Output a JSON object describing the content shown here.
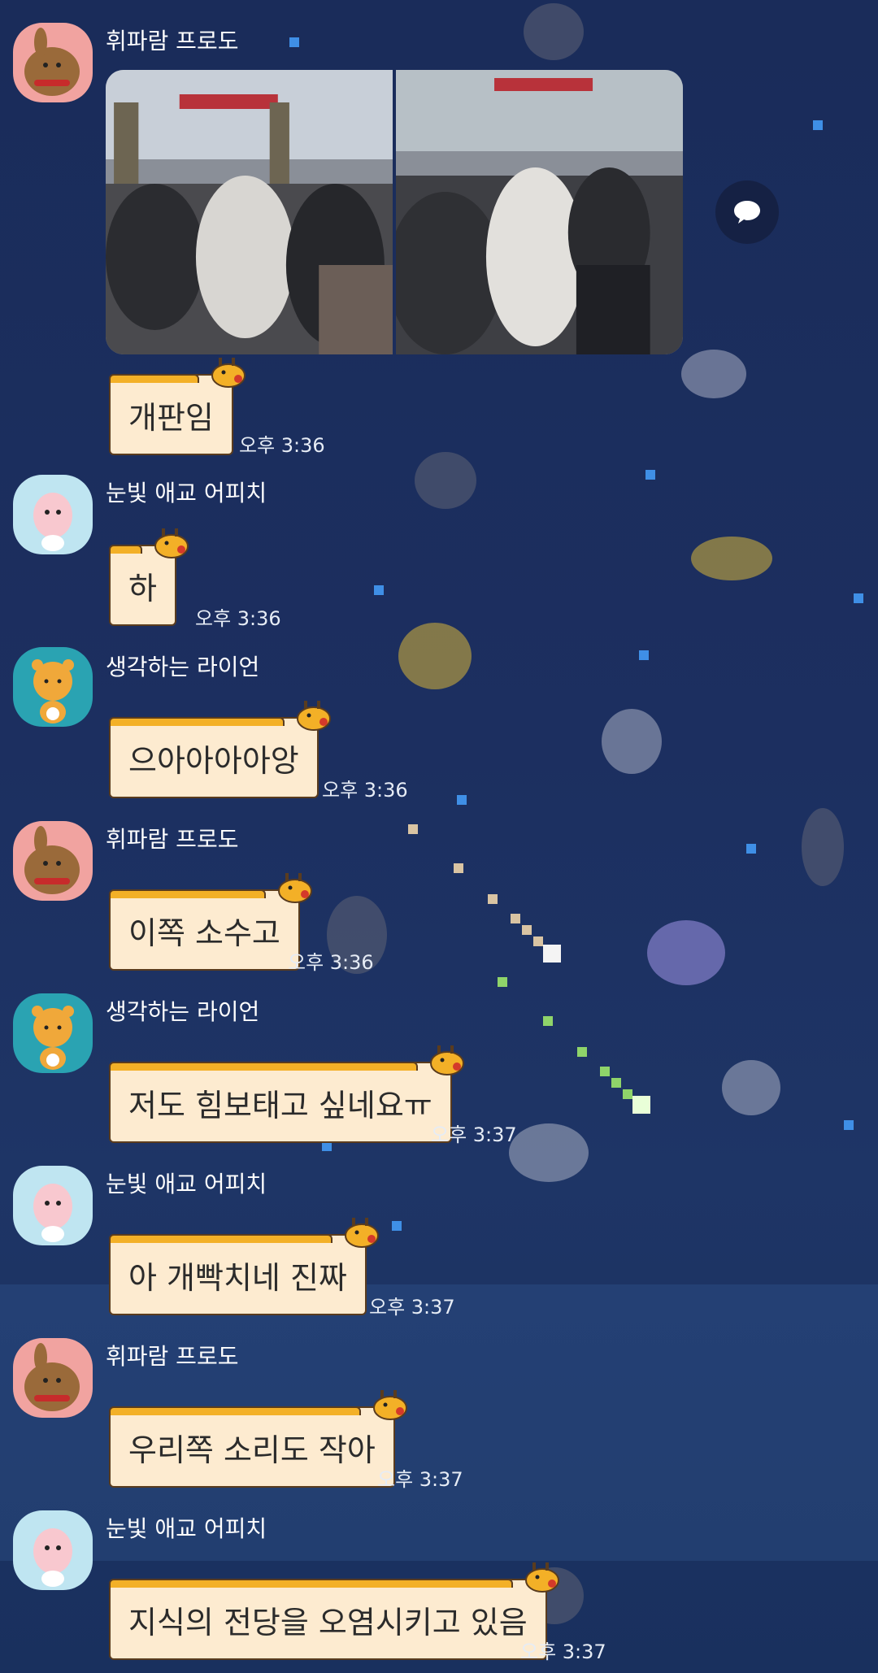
{
  "messages": [
    {
      "sender": "휘파람 프로도",
      "avatar": "frodo-avatar-icon",
      "text": "개판임",
      "time": "오후 3:36"
    },
    {
      "sender": "눈빛 애교 어피치",
      "avatar": "apeach-avatar-icon",
      "text": "하",
      "time": "오후 3:36"
    },
    {
      "sender": "생각하는 라이언",
      "avatar": "ryan-avatar-icon",
      "text": "으아아아아앙",
      "time": "오후 3:36"
    },
    {
      "sender": "휘파람 프로도",
      "avatar": "frodo-avatar-icon",
      "text": "이쪽 소수고",
      "time": "오후 3:36"
    },
    {
      "sender": "생각하는 라이언",
      "avatar": "ryan-avatar-icon",
      "text": "저도 힘보태고 싶네요ㅠ",
      "time": "오후 3:37"
    },
    {
      "sender": "눈빛 애교 어피치",
      "avatar": "apeach-avatar-icon",
      "text": "아 개빡치네 진짜",
      "time": "오후 3:37"
    },
    {
      "sender": "휘파람 프로도",
      "avatar": "frodo-avatar-icon",
      "text": "우리쪽 소리도 작아",
      "time": "오후 3:37"
    },
    {
      "sender": "눈빛 애교 어피치",
      "avatar": "apeach-avatar-icon",
      "text": "지식의 전당을 오염시키고 있음",
      "time": "오후 3:37"
    }
  ],
  "photo_message": {
    "images": [
      "crowd-photo-1",
      "crowd-photo-2"
    ]
  },
  "side_button": {
    "icon": "speech-bubble-icon"
  },
  "colors": {
    "background": "#1c2f60",
    "bubble": "#fdebd0",
    "bubble_accent": "#f3b027",
    "text_light": "#ffffff"
  }
}
